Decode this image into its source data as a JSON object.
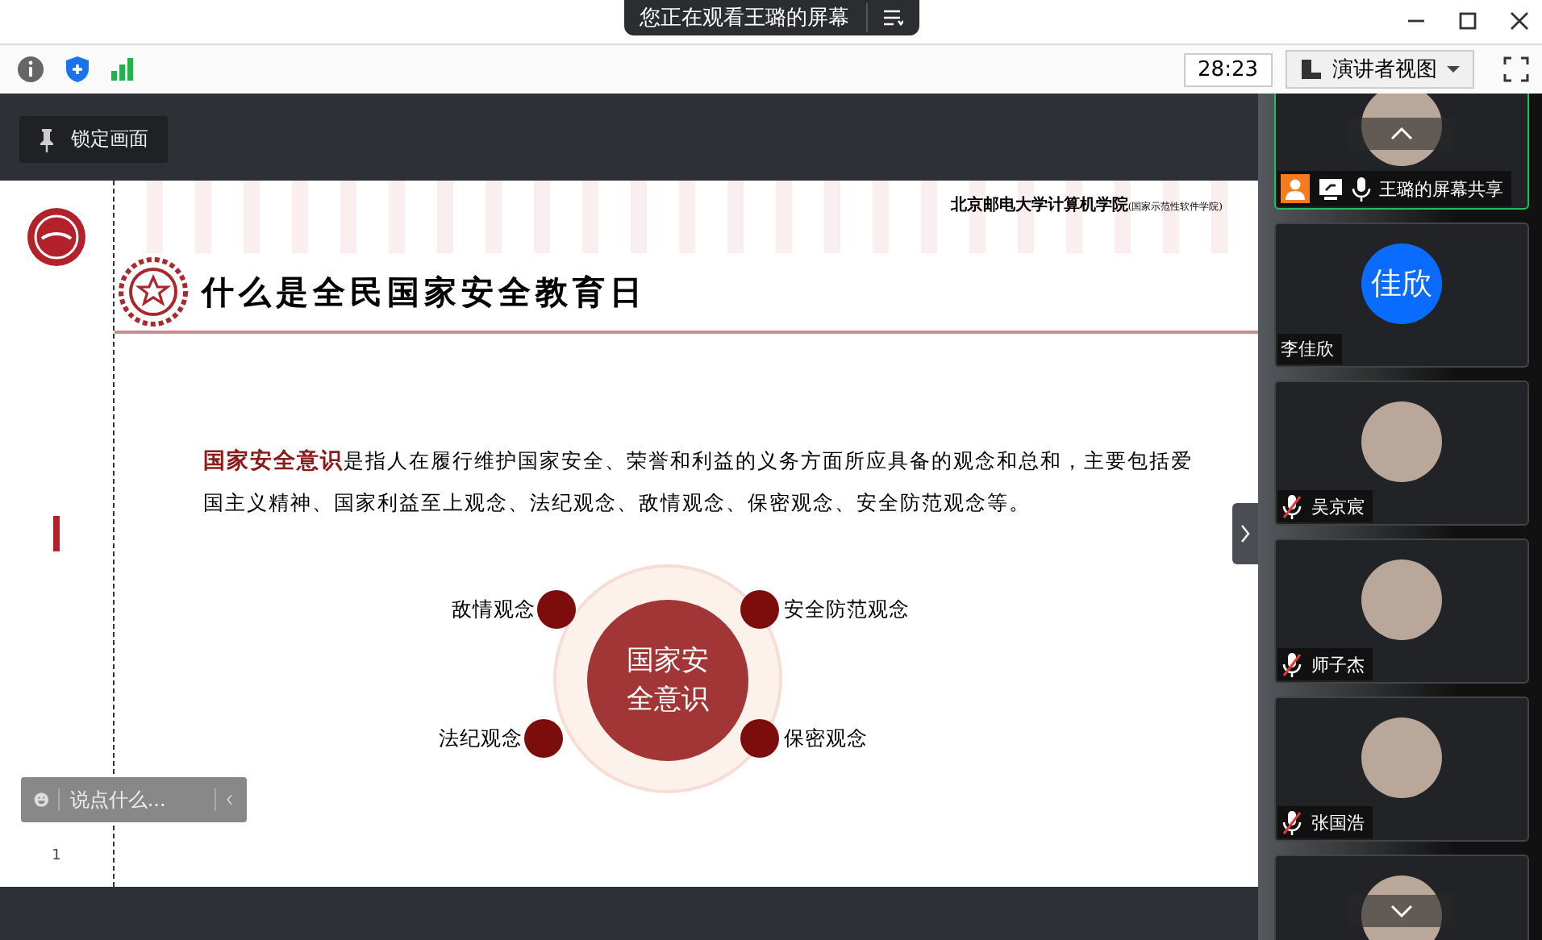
{
  "top_bar": {
    "banner": "您正在观看王璐的屏幕"
  },
  "toolbar": {
    "timer": "28:23",
    "view_button": "演讲者视图"
  },
  "shared_screen": {
    "lock_button": "锁定画面",
    "slide": {
      "school": "北京邮电大学计算机学院",
      "school_note": "(国家示范性软件学院)",
      "title": "什么是全民国家安全教育日",
      "paragraph": "**国家安全意识**是指人在履行维护国家安全、荣誉和利益的义务方面所应具备的观念和总和，主要包括爱国主义精神、国家利益至上观念、法纪观念、敌情观念、保密观念、安全防范观念等。",
      "center": "国家安全意识",
      "concepts": [
        {
          "label": "敌情观念"
        },
        {
          "label": "安全防范观念"
        },
        {
          "label": "法纪观念"
        },
        {
          "label": "保密观念"
        }
      ],
      "page": "1"
    },
    "chat": {
      "placeholder": "说点什么..."
    }
  },
  "participants": [
    {
      "name": "王璐的屏幕共享",
      "kind": "photo",
      "active": true,
      "presenter": true,
      "muted": false
    },
    {
      "name": "李佳欣",
      "kind": "initials",
      "initials": "佳欣",
      "color": "#0a6cff",
      "active": false,
      "presenter": false
    },
    {
      "name": "吴京宸",
      "kind": "photo",
      "active": false,
      "presenter": false,
      "muted": true
    },
    {
      "name": "师子杰",
      "kind": "photo",
      "active": false,
      "presenter": false,
      "muted": true
    },
    {
      "name": "张国浩",
      "kind": "photo",
      "active": false,
      "presenter": false,
      "muted": true
    },
    {
      "kind": "photo",
      "active": false,
      "presenter": false
    }
  ]
}
